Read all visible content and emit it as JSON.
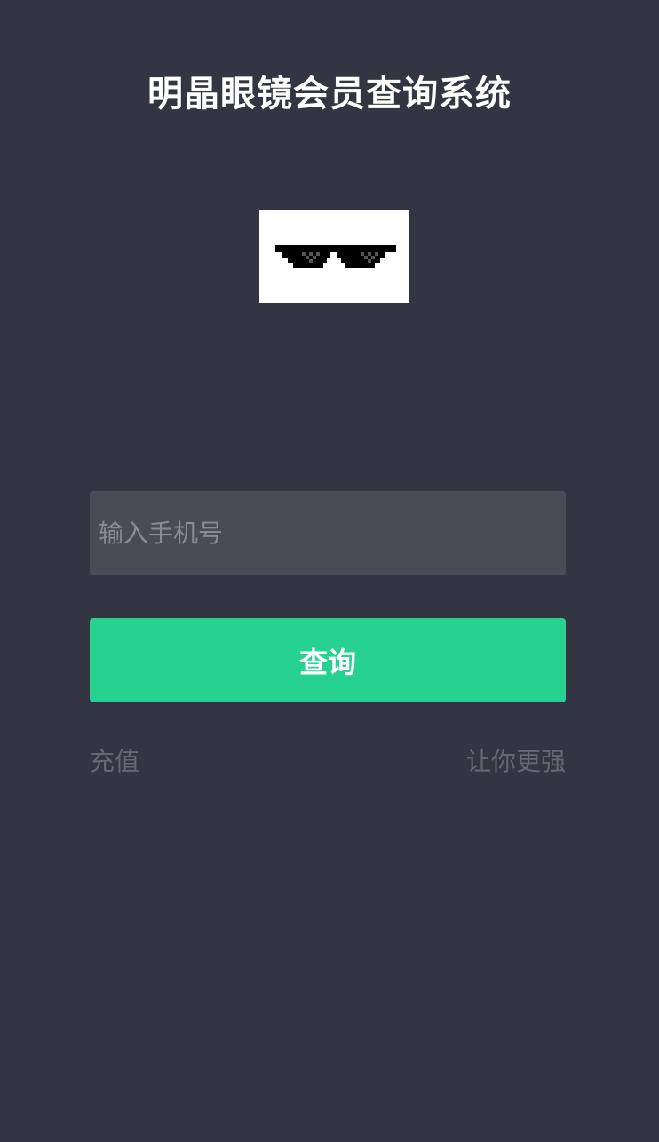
{
  "header": {
    "title": "明晶眼镜会员查询系统"
  },
  "logo": {
    "icon": "pixel-sunglasses-icon"
  },
  "form": {
    "phone_placeholder": "输入手机号",
    "phone_value": "",
    "query_label": "查询"
  },
  "links": {
    "recharge": "充值",
    "slogan": "让你更强"
  },
  "colors": {
    "background": "#333542",
    "input_background": "#4a4b56",
    "accent": "#27d18f",
    "link": "#656772"
  }
}
